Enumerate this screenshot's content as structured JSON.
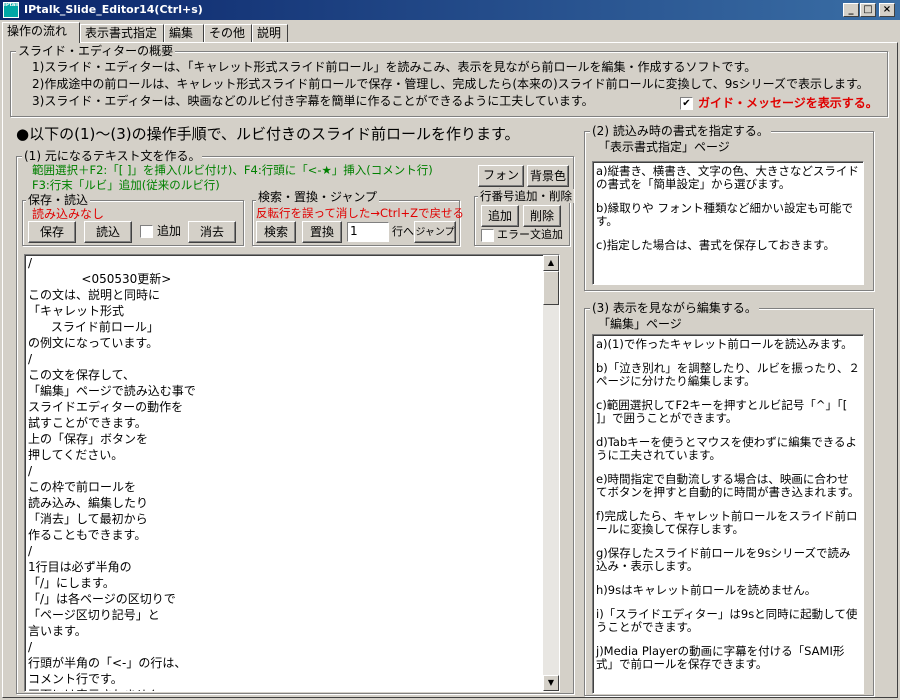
{
  "window": {
    "icon_text": "IPtalk",
    "title": "IPtalk_Slide_Editor14(Ctrl+s)",
    "minimize": "_",
    "maximize": "□",
    "close": "×"
  },
  "tabs": [
    "操作の流れ",
    "表示書式指定",
    "編集",
    "その他",
    "説明"
  ],
  "overview": {
    "label": "スライド・エディターの概要",
    "lines": [
      "1)スライド・エディターは、「キャレット形式スライド前ロール」を読みこみ、表示を見ながら前ロールを編集・作成するソフトです。",
      "2)作成途中の前ロールは、キャレット形式スライド前ロールで保存・管理し、完成したら(本来の)スライド前ロールに変換して、9sシリーズで表示します。",
      "3)スライド・エディターは、映画などのルビ付き字幕を簡単に作ることができるように工夫しています。"
    ],
    "guide_checkbox_label": "ガイド・メッセージを表示する。",
    "guide_checked": "✔"
  },
  "heading": "●以下の(1)～(3)の操作手順で、ルビ付きのスライド前ロールを作ります。",
  "step1": {
    "label": "(1) 元になるテキスト文を作る。",
    "hint1": "範囲選択＋F2:「[ ]」を挿入(ルビ付け)、F4:行頭に「<-★」挿入(コメント行)",
    "hint2": "F3:行末「ルビ」追加(従来のルビ行)",
    "font_button": "フォント",
    "bgcolor_button": "背景色",
    "saveload": {
      "label": "保存・読込",
      "status": "読み込みなし",
      "save_button": "保存",
      "load_button": "読込",
      "append_label": "追加",
      "clear_button": "消去"
    },
    "search": {
      "label": "検索・置換・ジャンプ",
      "warning": "反転行を誤って消した→Ctrl+Zで戻せる",
      "search_button": "検索",
      "replace_button": "置換",
      "line_value": "1",
      "line_suffix": "行へ",
      "jump_button": "ジャンプ"
    },
    "lineno": {
      "label": "行番号追加・削除",
      "add_button": "追加",
      "delete_button": "削除",
      "error_label": "エラー文追加"
    },
    "editor_lines": [
      "/",
      "              <050530更新>",
      "この文は、説明と同時に",
      "「キャレット形式",
      "      スライド前ロール」",
      "の例文になっています。",
      "/",
      "この文を保存して、",
      "「編集」ページで読み込む事で",
      "スライドエディターの動作を",
      "試すことができます。",
      "上の「保存」ボタンを",
      "押してください。",
      "/",
      "この枠で前ロールを",
      "読み込み、編集したり",
      "「消去」して最初から",
      "作ることもできます。",
      "/",
      "1行目は必ず半角の",
      "「/」にします。",
      "「/」は各ページの区切りで",
      "「ページ区切り記号」と",
      "言います。",
      "/",
      "行頭が半角の「<-」の行は、",
      "コメント行です。",
      "画面には表示されません。"
    ]
  },
  "step2": {
    "label": "(2) 読込み時の書式を指定する。",
    "page_label": "「表示書式指定」ページ",
    "items": [
      "a)縦書き、横書き、文字の色、大きさなどスライドの書式を「簡単設定」から選びます。",
      "b)縁取りや フォント種類など細かい設定も可能です。",
      "c)指定した場合は、書式を保存しておきます。"
    ]
  },
  "step3": {
    "label": "(3) 表示を見ながら編集する。",
    "page_label": "「編集」ページ",
    "items": [
      "a)(1)で作ったキャレット前ロールを読込みます。",
      "b)「泣き別れ」を調整したり、ルビを振ったり、２ページに分けたり編集します。",
      "c)範囲選択してF2キーを押すとルビ記号「^」「[ ]」で囲うことができます。",
      "d)Tabキーを使うとマウスを使わずに編集できるように工夫されています。",
      "e)時間指定で自動流しする場合は、映画に合わせてボタンを押すと自動的に時間が書き込まれます。",
      "f)完成したら、キャレット前ロールをスライド前ロールに変換して保存します。",
      "g)保存したスライド前ロールを9sシリーズで読み込み・表示します。",
      "h)9sはキャレット前ロールを読めません。",
      "i)「スライドエディター」は9sと同時に起動して使うことができます。",
      "j)Media Playerの動画に字幕を付ける「SAMI形式」で前ロールを保存できます。"
    ]
  },
  "colors": {
    "title_bar": "#0a246a",
    "guide_red": "#e00000",
    "hint_green": "#008000"
  }
}
